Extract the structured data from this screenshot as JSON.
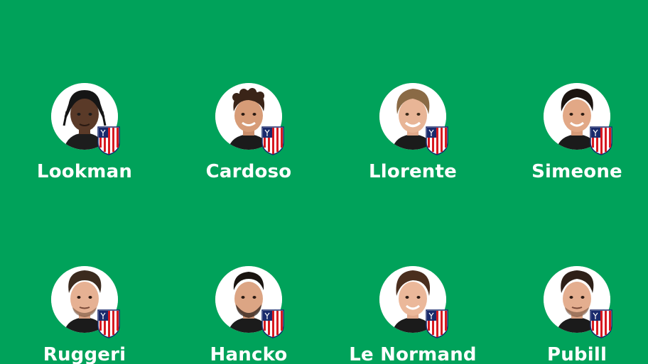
{
  "colors": {
    "background": "#00a25a",
    "name_text": "#ffffff",
    "avatar_bg": "#ffffff"
  },
  "players": [
    {
      "name": "Lookman",
      "badge": "atletico-madrid-badge-icon"
    },
    {
      "name": "Cardoso",
      "badge": "atletico-madrid-badge-icon"
    },
    {
      "name": "Llorente",
      "badge": "atletico-madrid-badge-icon"
    },
    {
      "name": "Simeone",
      "badge": "atletico-madrid-badge-icon"
    },
    {
      "name": "Ruggeri",
      "badge": "atletico-madrid-badge-icon"
    },
    {
      "name": "Hancko",
      "badge": "atletico-madrid-badge-icon"
    },
    {
      "name": "Le Normand",
      "badge": "atletico-madrid-badge-icon"
    },
    {
      "name": "Pubill",
      "badge": "atletico-madrid-badge-icon"
    }
  ]
}
